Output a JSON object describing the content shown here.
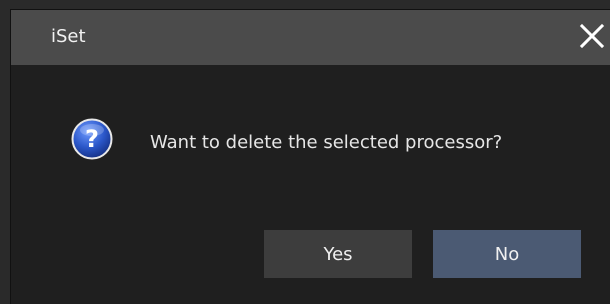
{
  "window": {
    "title": "iSet",
    "close_icon": "close-icon"
  },
  "dialog": {
    "icon": "question-icon",
    "message": "Want to delete the selected processor?",
    "yes_label": "Yes",
    "no_label": "No"
  },
  "colors": {
    "titlebar": "#4b4b4b",
    "body": "#1f1f1f",
    "yes_button": "#3d3d3d",
    "no_button": "#4b5a73",
    "icon_blue": "#1f4fb0"
  }
}
